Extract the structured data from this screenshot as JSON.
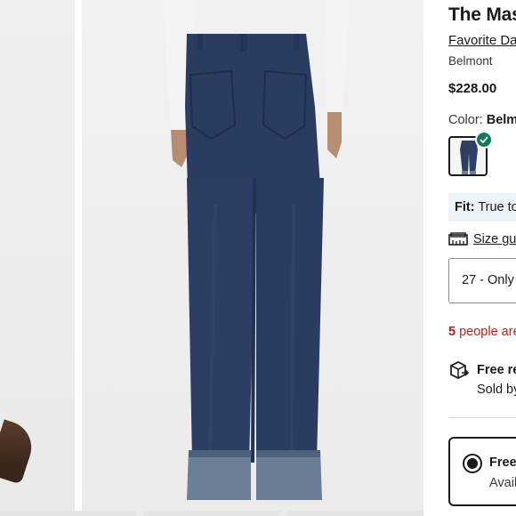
{
  "product": {
    "title": "The Mas",
    "brand_link": "Favorite Da",
    "color_subtitle": "Belmont",
    "price": "$228.00"
  },
  "color": {
    "label": "Color:",
    "selected": "Belmo",
    "swatch_icon": "jeans-swatch-icon",
    "check_icon": "check-icon",
    "check_color": "#0f7a5a"
  },
  "fit": {
    "label": "Fit:",
    "value": "True to"
  },
  "size_guide": {
    "icon": "ruler-icon",
    "label": "Size guid"
  },
  "size_select": {
    "value": "27 - Only"
  },
  "urgency": {
    "count": "5",
    "text": "people are",
    "color": "#c21b17"
  },
  "returns": {
    "icon": "return-box-icon",
    "title": "Free ret",
    "subtitle": "Sold by"
  },
  "shipping_option": {
    "title": "Free",
    "subtitle": "Avail"
  }
}
